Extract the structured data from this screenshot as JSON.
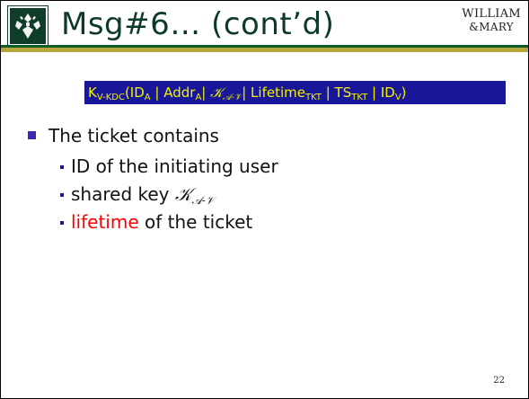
{
  "header": {
    "title": "Msg#6… (cont’d)",
    "wordmark_line1": "WILLIAM",
    "wordmark_line2": "&MARY"
  },
  "formula": {
    "k": "K",
    "k_sub": "V-KDC",
    "open": "(ID",
    "id_sub": "A",
    "sep1": " | Addr",
    "addr_sub": "A",
    "sep2": "| ",
    "key_script": "𝒦",
    "key_sub": "𝒜-𝒱",
    "sep3": "| Lifetime",
    "lifetime_sub": "TKT",
    "sep4": " | TS",
    "ts_sub": "TKT",
    "sep5": " | ID",
    "idv_sub": "V",
    "close": ")"
  },
  "bullets": {
    "main": "The ticket contains",
    "sub1": "ID of the initiating user",
    "sub2_prefix": "shared key ",
    "sub2_key": "𝒦",
    "sub2_key_sub": "𝒜-𝒱",
    "sub3_highlight": "lifetime",
    "sub3_rest": " of the ticket"
  },
  "page_number": "22",
  "colors": {
    "brand_green": "#0f3d2a",
    "gold": "#b9a63a",
    "formula_bg": "#18179a",
    "formula_text": "#f2f200",
    "highlight_red": "#ff0000"
  }
}
